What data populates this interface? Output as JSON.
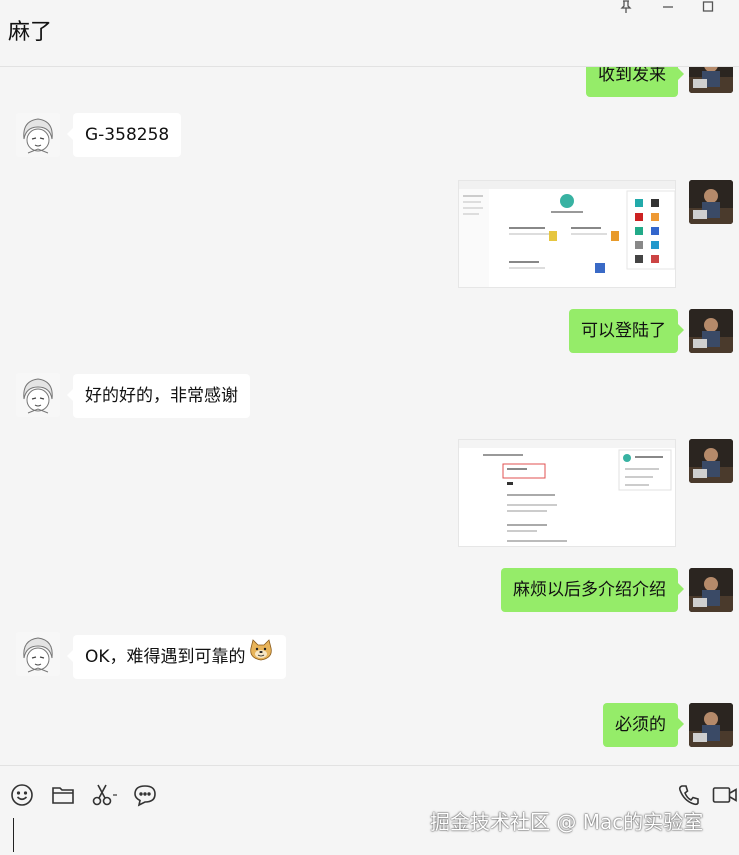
{
  "window": {
    "title": "麻了"
  },
  "messages": [
    {
      "side": "right",
      "type": "text",
      "text": "收到发来"
    },
    {
      "side": "left",
      "type": "text",
      "text": "G-358258"
    },
    {
      "side": "right",
      "type": "image",
      "alt": "screenshot"
    },
    {
      "side": "right",
      "type": "text",
      "text": "可以登陆了"
    },
    {
      "side": "left",
      "type": "text",
      "text": "好的好的，非常感谢"
    },
    {
      "side": "right",
      "type": "image",
      "alt": "screenshot"
    },
    {
      "side": "right",
      "type": "text",
      "text": "麻烦以后多介绍介绍"
    },
    {
      "side": "left",
      "type": "text",
      "text": "OK，难得遇到可靠的"
    },
    {
      "side": "right",
      "type": "text",
      "text": "必须的"
    }
  ],
  "toolbar": {
    "icons": [
      "emoji-icon",
      "folder-icon",
      "scissors-icon",
      "chat-history-icon",
      "phone-icon",
      "video-icon"
    ]
  },
  "watermark": "掘金技术社区 @ Mac的实验室",
  "colors": {
    "sent_bubble": "#95ec69",
    "received_bubble": "#ffffff",
    "background": "#f5f5f5"
  }
}
